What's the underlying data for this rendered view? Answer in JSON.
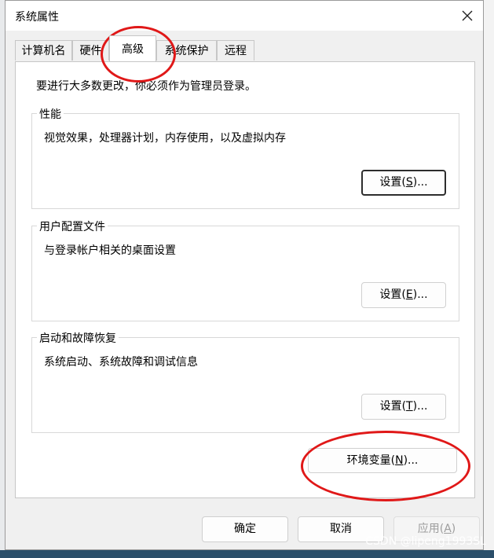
{
  "window": {
    "title": "系统属性"
  },
  "tabs": [
    {
      "label": "计算机名",
      "active": false
    },
    {
      "label": "硬件",
      "active": false
    },
    {
      "label": "高级",
      "active": true
    },
    {
      "label": "系统保护",
      "active": false
    },
    {
      "label": "远程",
      "active": false
    }
  ],
  "admin_note": "要进行大多数更改，你必须作为管理员登录。",
  "groups": {
    "performance": {
      "title": "性能",
      "description": "视觉效果，处理器计划，内存使用，以及虚拟内存",
      "button": {
        "text": "设置(",
        "key": "S",
        "suffix": ")..."
      }
    },
    "user_profiles": {
      "title": "用户配置文件",
      "description": "与登录帐户相关的桌面设置",
      "button": {
        "text": "设置(",
        "key": "E",
        "suffix": ")..."
      }
    },
    "startup_recovery": {
      "title": "启动和故障恢复",
      "description": "系统启动、系统故障和调试信息",
      "button": {
        "text": "设置(",
        "key": "T",
        "suffix": ")..."
      }
    }
  },
  "env_button": {
    "text": "环境变量(",
    "key": "N",
    "suffix": ")..."
  },
  "footer": {
    "ok": "确定",
    "cancel": "取消",
    "apply": {
      "text": "应用(",
      "key": "A",
      "suffix": ")"
    }
  },
  "watermark": "CSDN @lipeng1993SL",
  "colors": {
    "annotation_red": "#e01818",
    "dialog_bg": "#f0f0f0",
    "panel_bg": "#ffffff"
  },
  "icons": {
    "close": "close-icon"
  }
}
